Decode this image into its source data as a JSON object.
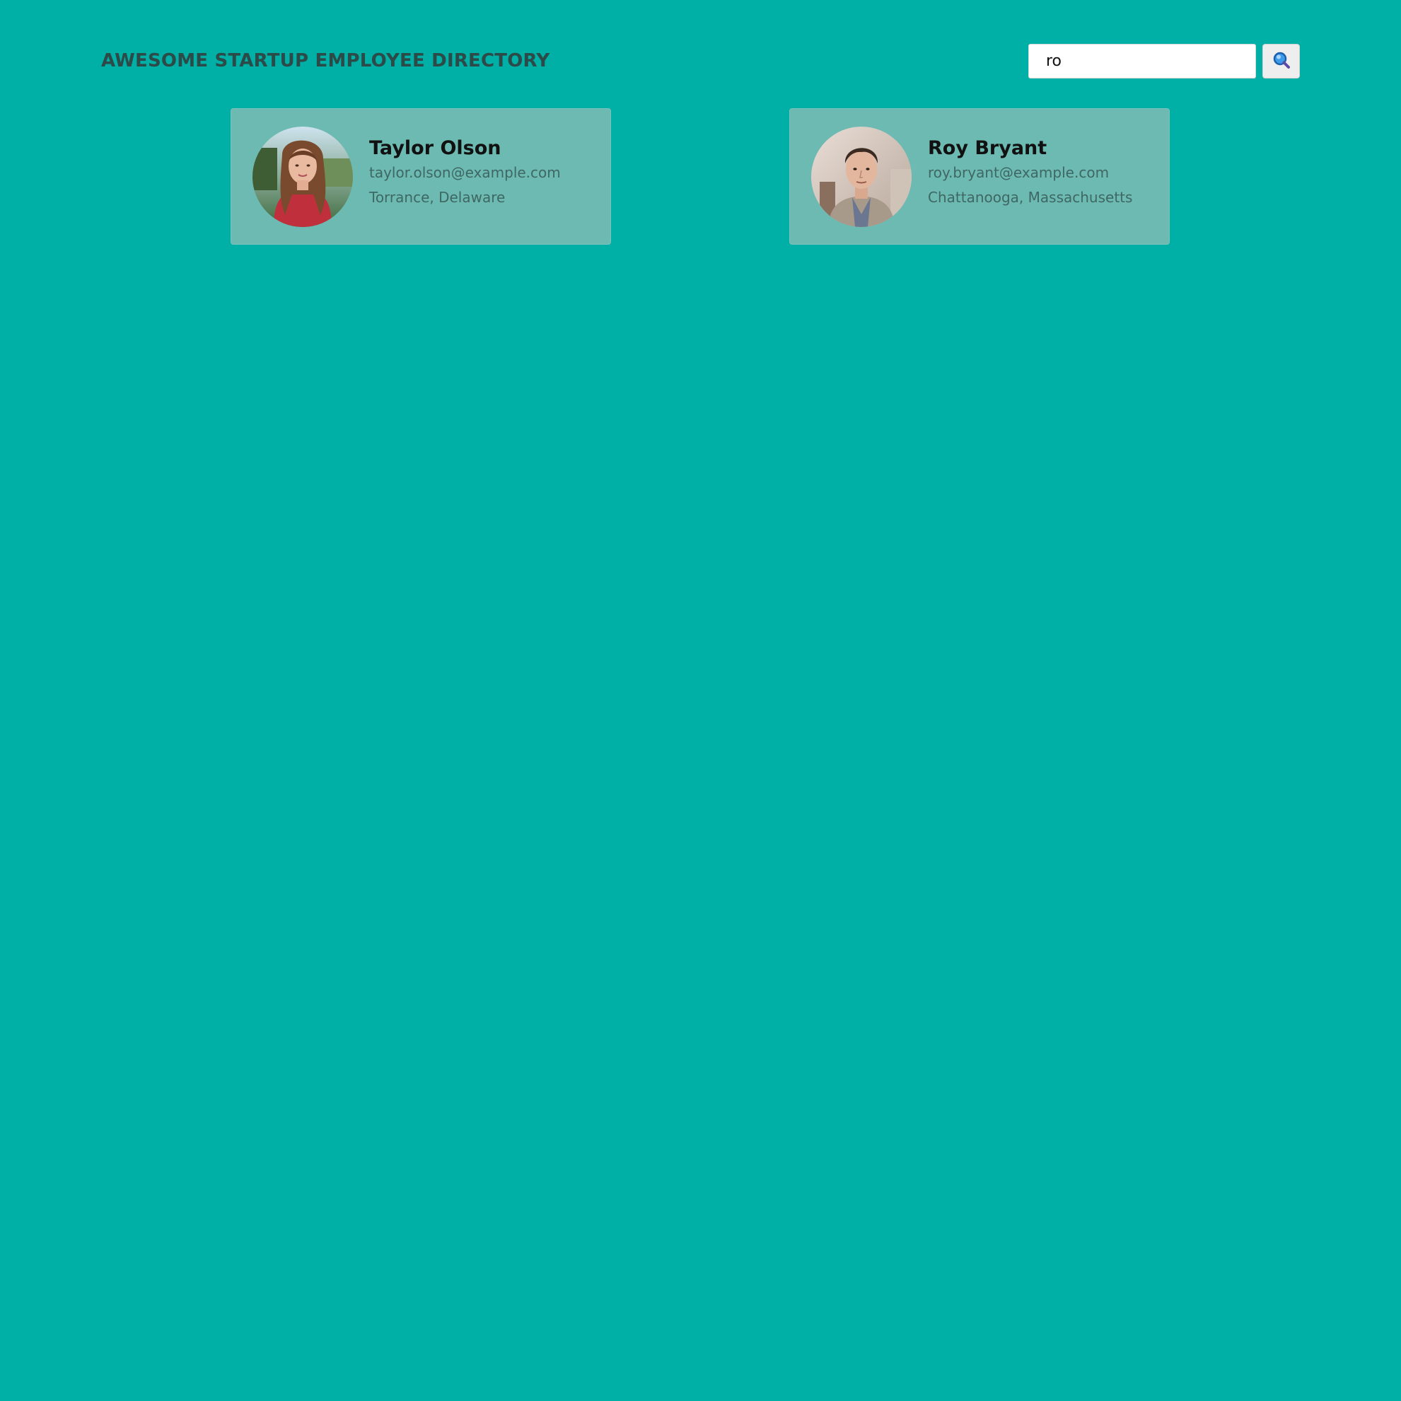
{
  "header": {
    "title": "AWESOME STARTUP EMPLOYEE DIRECTORY"
  },
  "search": {
    "value": "ro",
    "button_icon": "search-icon"
  },
  "colors": {
    "background": "#00afa6",
    "card": "#6cbab1",
    "title": "#2c4a48"
  },
  "employees": [
    {
      "name": "Taylor Olson",
      "email": "taylor.olson@example.com",
      "location": "Torrance, Delaware"
    },
    {
      "name": "Roy Bryant",
      "email": "roy.bryant@example.com",
      "location": "Chattanooga, Massachusetts"
    }
  ]
}
